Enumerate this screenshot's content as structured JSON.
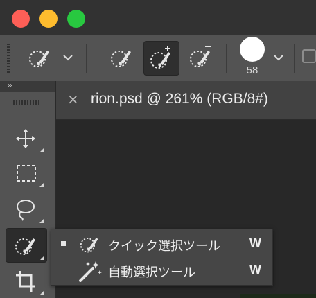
{
  "window": {
    "controls": [
      "close-button",
      "minimize-button",
      "zoom-button"
    ]
  },
  "options_bar": {
    "brush_size": "58",
    "icons": [
      "quick-selection-preset-icon",
      "new-selection-icon",
      "add-to-selection-icon",
      "subtract-from-selection-icon",
      "brush-preset-icon"
    ]
  },
  "toolbox": {
    "collapse_label": "››",
    "tools": [
      "move-tool-icon",
      "marquee-tool-icon",
      "lasso-tool-icon",
      "quick-selection-tool-icon",
      "crop-tool-icon"
    ]
  },
  "document": {
    "close_label": "×",
    "title": "rion.psd @ 261% (RGB/8#)"
  },
  "flyout": {
    "items": [
      {
        "label": "クイック選択ツール",
        "shortcut": "W",
        "selected": true,
        "icon": "quick-selection-icon"
      },
      {
        "label": "自動選択ツール",
        "shortcut": "W",
        "selected": false,
        "icon": "magic-wand-icon"
      }
    ]
  },
  "colors": {
    "close": "#fe5f57",
    "minimize": "#febc2e",
    "zoom": "#28c840",
    "panel": "#535353",
    "canvas": "#282828"
  }
}
